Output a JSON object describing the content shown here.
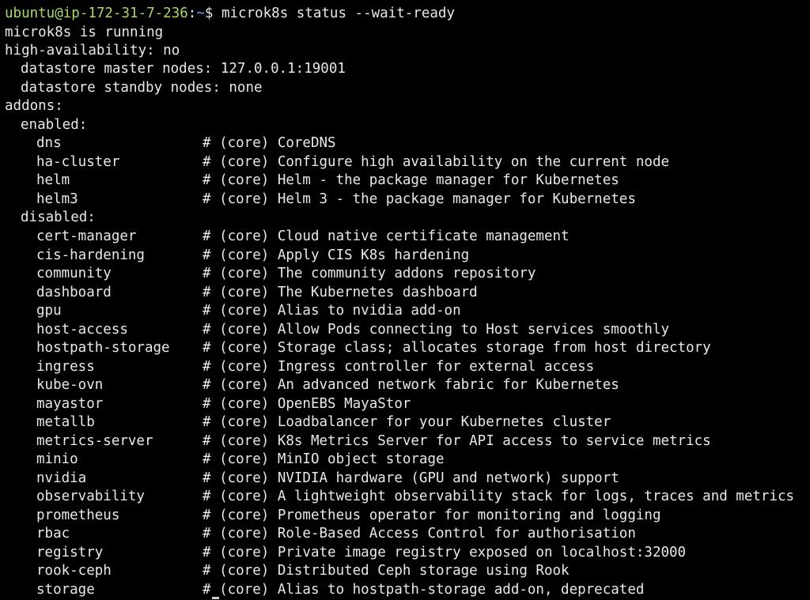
{
  "prompt": {
    "user_host": "ubuntu@ip-172-31-7-236",
    "separator": ":",
    "path": "~",
    "symbol": "$ ",
    "command": "microk8s status --wait-ready"
  },
  "status": {
    "running": "microk8s is running",
    "ha": "high-availability: no",
    "master": "datastore master nodes: 127.0.0.1:19001",
    "standby": "datastore standby nodes: none",
    "addons_header": "addons:",
    "enabled_header": "enabled:",
    "disabled_header": "disabled:"
  },
  "enabled": [
    {
      "name": "dns",
      "desc": "# (core) CoreDNS"
    },
    {
      "name": "ha-cluster",
      "desc": "# (core) Configure high availability on the current node"
    },
    {
      "name": "helm",
      "desc": "# (core) Helm - the package manager for Kubernetes"
    },
    {
      "name": "helm3",
      "desc": "# (core) Helm 3 - the package manager for Kubernetes"
    }
  ],
  "disabled": [
    {
      "name": "cert-manager",
      "desc": "# (core) Cloud native certificate management"
    },
    {
      "name": "cis-hardening",
      "desc": "# (core) Apply CIS K8s hardening"
    },
    {
      "name": "community",
      "desc": "# (core) The community addons repository"
    },
    {
      "name": "dashboard",
      "desc": "# (core) The Kubernetes dashboard"
    },
    {
      "name": "gpu",
      "desc": "# (core) Alias to nvidia add-on"
    },
    {
      "name": "host-access",
      "desc": "# (core) Allow Pods connecting to Host services smoothly"
    },
    {
      "name": "hostpath-storage",
      "desc": "# (core) Storage class; allocates storage from host directory"
    },
    {
      "name": "ingress",
      "desc": "# (core) Ingress controller for external access"
    },
    {
      "name": "kube-ovn",
      "desc": "# (core) An advanced network fabric for Kubernetes"
    },
    {
      "name": "mayastor",
      "desc": "# (core) OpenEBS MayaStor"
    },
    {
      "name": "metallb",
      "desc": "# (core) Loadbalancer for your Kubernetes cluster"
    },
    {
      "name": "metrics-server",
      "desc": "# (core) K8s Metrics Server for API access to service metrics"
    },
    {
      "name": "minio",
      "desc": "# (core) MinIO object storage"
    },
    {
      "name": "nvidia",
      "desc": "# (core) NVIDIA hardware (GPU and network) support"
    },
    {
      "name": "observability",
      "desc": "# (core) A lightweight observability stack for logs, traces and metrics"
    },
    {
      "name": "prometheus",
      "desc": "# (core) Prometheus operator for monitoring and logging"
    },
    {
      "name": "rbac",
      "desc": "# (core) Role-Based Access Control for authorisation"
    },
    {
      "name": "registry",
      "desc": "# (core) Private image registry exposed on localhost:32000"
    },
    {
      "name": "rook-ceph",
      "desc": "# (core) Distributed Ceph storage using Rook"
    },
    {
      "name": "storage",
      "desc": "# (core) Alias to hostpath-storage add-on, deprecated"
    }
  ],
  "colors": {
    "background": "#000000",
    "text": "#e8e8e8",
    "prompt_user": "#a8d86a",
    "prompt_path": "#6aa6ff"
  }
}
